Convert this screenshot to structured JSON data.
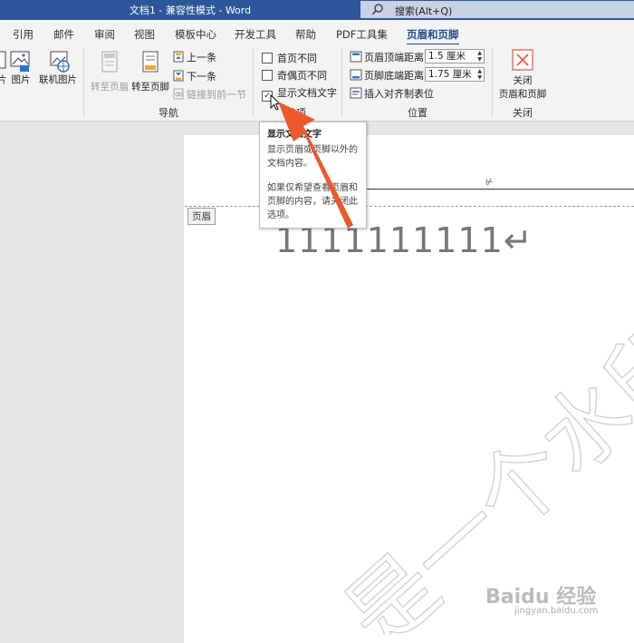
{
  "titlebar": {
    "title": "文档1  -  兼容性模式  -  Word",
    "search_text": "搜索(Alt+Q)"
  },
  "tabs": [
    {
      "label": "引用"
    },
    {
      "label": "邮件"
    },
    {
      "label": "审阅"
    },
    {
      "label": "视图"
    },
    {
      "label": "模板中心"
    },
    {
      "label": "开发工具"
    },
    {
      "label": "帮助"
    },
    {
      "label": "PDF工具集"
    },
    {
      "label": "页眉和页脚",
      "active": true
    }
  ],
  "ribbon": {
    "insert": {
      "picture_label": "图片",
      "online_picture_label": "联机图片",
      "partial_label": "片"
    },
    "navigation": {
      "group_label": "导航",
      "goto_header": "转至页眉",
      "goto_footer": "转至页脚",
      "previous": "上一条",
      "next": "下一条",
      "link_previous": "链接到前一节"
    },
    "options": {
      "group_label": "选项",
      "first_page_diff": "首页不同",
      "first_page_checked": false,
      "odd_even_diff": "奇偶页不同",
      "odd_even_checked": false,
      "show_doc_text": "显示文档文字",
      "show_doc_text_checked": true
    },
    "position": {
      "group_label": "位置",
      "header_top_label": "页眉顶端距离:",
      "header_top_value": "1.5 厘米",
      "footer_bottom_label": "页脚底端距离:",
      "footer_bottom_value": "1.75 厘米",
      "insert_tab": "插入对齐制表位"
    },
    "close": {
      "group_label": "关闭",
      "line1": "关闭",
      "line2": "页眉和页脚"
    }
  },
  "tooltip": {
    "title": "显示文档文字",
    "p1": "显示页眉或页脚以外的文档内容。",
    "p2": "如果仅希望查看页眉和页脚的内容，请关闭此选项。"
  },
  "document": {
    "header_tag": "页眉",
    "body_text": "1111111111↵",
    "watermark_text": "是一个水印",
    "cursor_mark": "⊬"
  },
  "footer": {
    "brand": "Baidu 经验",
    "url": "jingyan.baidu.com"
  },
  "colors": {
    "title_bar": "#2b579a",
    "accent": "#1f4e96",
    "arrow": "#ec5a2b",
    "close_x": "#e2583e"
  }
}
